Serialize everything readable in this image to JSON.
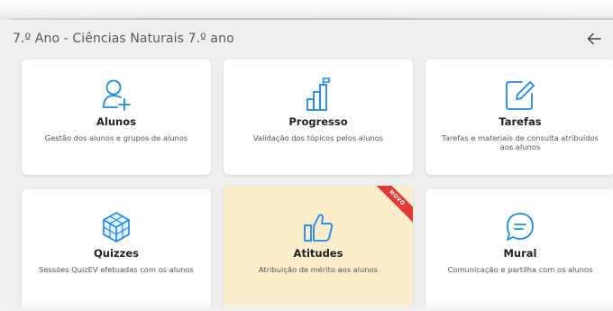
{
  "header": {
    "title": "7.º Ano - Ciências Naturais 7.º ano",
    "back_icon": "arrow-left-icon"
  },
  "colors": {
    "accent_blue": "#1e88e5",
    "highlight_card": "#fbeccb",
    "ribbon_red": "#e53935"
  },
  "cards": [
    {
      "id": "alunos",
      "icon": "add-user-icon",
      "title": "Alunos",
      "description": "Gestão dos alunos e grupos de alunos"
    },
    {
      "id": "progresso",
      "icon": "bar-chart-flag-icon",
      "title": "Progresso",
      "description": "Validação dos tópicos pelos alunos"
    },
    {
      "id": "tarefas",
      "icon": "edit-square-icon",
      "title": "Tarefas",
      "description": "Tarefas e materiais de consulta atribuídos aos alunos"
    },
    {
      "id": "quizzes",
      "icon": "cube-grid-icon",
      "title": "Quizzes",
      "description": "Sessões QuizEV efetuadas com os alunos"
    },
    {
      "id": "atitudes",
      "icon": "thumbs-up-icon",
      "title": "Atitudes",
      "description": "Atribuição de mérito aos alunos",
      "badge": "NOVO"
    },
    {
      "id": "mural",
      "icon": "chat-bubble-icon",
      "title": "Mural",
      "description": "Comunicação e partilha com os alunos"
    }
  ]
}
